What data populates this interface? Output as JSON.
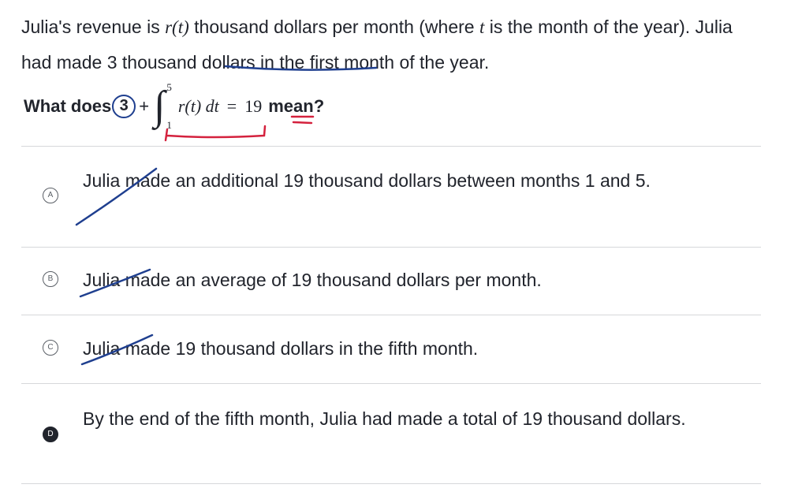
{
  "stem": {
    "part1": "Julia's revenue is ",
    "r_t": "r(t)",
    "part2": " thousand dollars per month (where ",
    "t": "t",
    "part3": " is the month of the year). Julia had made ",
    "underlined": "3 thousand dollars",
    "part4": " in the first month of the year."
  },
  "question": {
    "prefix": "What does",
    "initial": "3",
    "plus": "+",
    "upper_limit": "5",
    "lower_limit": "1",
    "integrand": "r(t) dt",
    "equals": "=",
    "value": "19",
    "suffix": "mean?"
  },
  "choices": [
    {
      "letter": "A",
      "text": "Julia made an additional 19 thousand dollars between months 1 and 5.",
      "selected": false
    },
    {
      "letter": "B",
      "text": "Julia made an average of 19 thousand dollars per month.",
      "selected": false
    },
    {
      "letter": "C",
      "text": "Julia made 19 thousand dollars in the fifth month.",
      "selected": false
    },
    {
      "letter": "D",
      "text": "By the end of the fifth month, Julia had made a total of 19 thousand dollars.",
      "selected": true
    }
  ],
  "colors": {
    "text": "#21242c",
    "ink_blue": "#1f3f8f",
    "ink_red": "#d4213d",
    "divider": "#d6d8da"
  }
}
